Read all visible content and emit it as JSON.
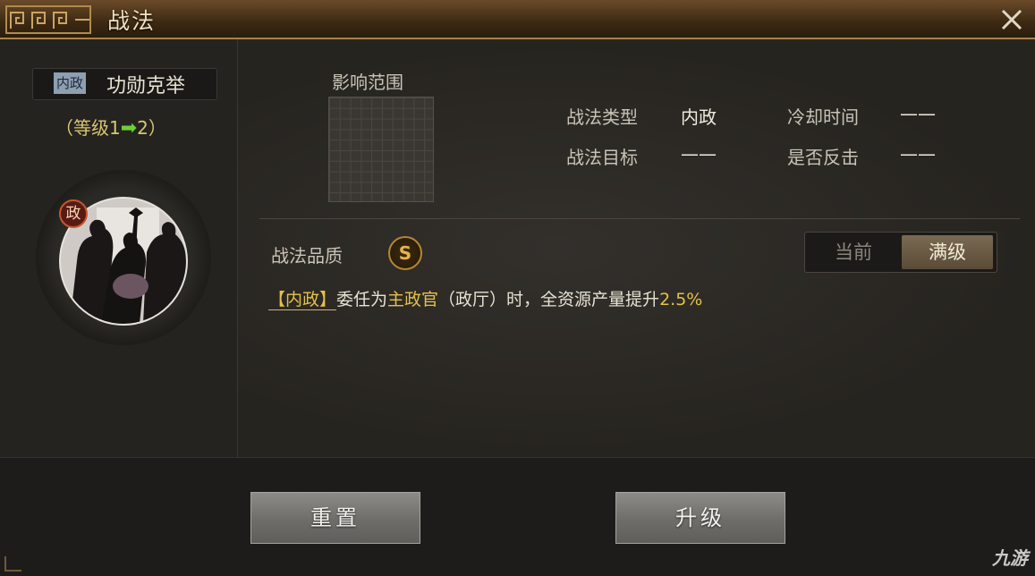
{
  "window": {
    "title": "战法",
    "close_icon": "close-icon"
  },
  "skill": {
    "type_tag": "内政",
    "name": "功勋克举",
    "level_open": "（等级1",
    "level_arrow": "➡",
    "level_close": "2）",
    "portrait_badge": "政"
  },
  "info": {
    "range_label": "影响范围",
    "type_label": "战法类型",
    "type_value": "内政",
    "cooldown_label": "冷却时间",
    "cooldown_value": "——",
    "target_label": "战法目标",
    "target_value": "——",
    "counter_label": "是否反击",
    "counter_value": "——"
  },
  "quality": {
    "label": "战法品质",
    "grade": "S"
  },
  "toggle": {
    "current": "当前",
    "max": "满级",
    "selected": "max"
  },
  "description": {
    "tag": "【内政】",
    "part1": "委任为",
    "role": "主政官",
    "part2": "（政厅）时，全资源产量提升",
    "amount": "2.5%"
  },
  "buttons": {
    "reset": "重置",
    "upgrade": "升级"
  },
  "watermark": "九游",
  "colors": {
    "accent_gold": "#e6c04a",
    "title_bar": "#3c2912",
    "level_arrow": "#6ccf3a",
    "quality_ring": "#b8862f"
  }
}
